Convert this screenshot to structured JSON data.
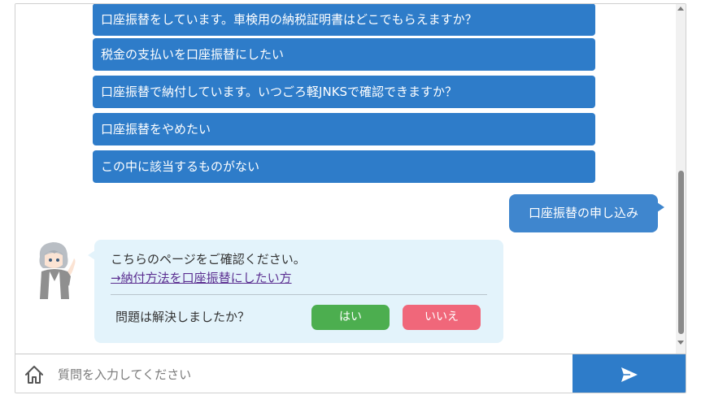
{
  "options": [
    {
      "label": "口座振替をしています。車検用の納税証明書はどこでもらえますか？"
    },
    {
      "label": "税金の支払いを口座振替にしたい"
    },
    {
      "label": "口座振替で納付しています。いつごろ軽JNKSで確認できますか？"
    },
    {
      "label": "口座振替をやめたい"
    },
    {
      "label": "この中に該当するものがない"
    }
  ],
  "user_message": "口座振替の申し込み",
  "bot_message": {
    "text": "こちらのページをご確認ください。",
    "link": "→納付方法を口座振替にしたい方",
    "resolved_question": "問題は解決しましたか？",
    "yes_label": "はい",
    "no_label": "いいえ"
  },
  "input": {
    "placeholder": "質問を入力してください"
  },
  "colors": {
    "option_bg": "#2e7cc9",
    "user_bubble_bg": "#3f86ce",
    "bot_bubble_bg": "#e3f3fb",
    "yes_bg": "#4cae4f",
    "no_bg": "#f0677a",
    "send_bg": "#2e7cc9"
  },
  "icons": {
    "home": "home-icon",
    "send": "send-icon"
  }
}
